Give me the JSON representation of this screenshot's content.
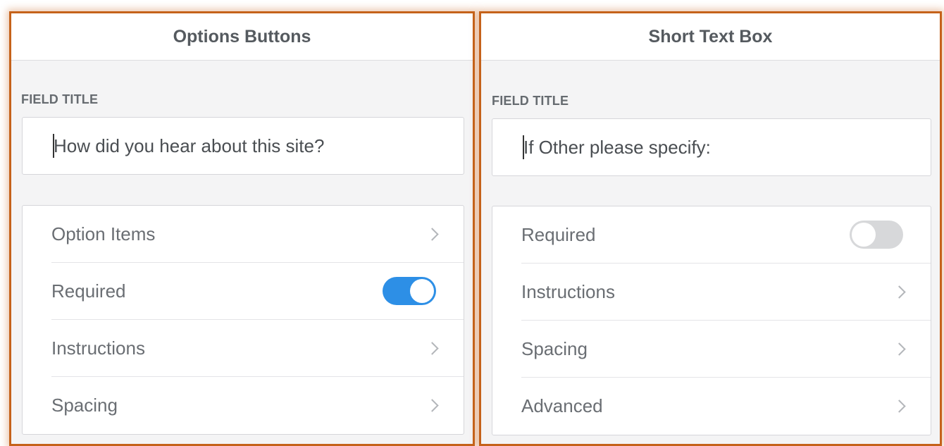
{
  "left_panel": {
    "header": "Options Buttons",
    "field_title_label": "FIELD TITLE",
    "field_title_value": "How did you hear about this site?",
    "rows": [
      {
        "label": "Option Items",
        "control": "chevron"
      },
      {
        "label": "Required",
        "control": "toggle",
        "toggle_state": "on"
      },
      {
        "label": "Instructions",
        "control": "chevron"
      },
      {
        "label": "Spacing",
        "control": "chevron"
      }
    ]
  },
  "right_panel": {
    "header": "Short Text Box",
    "field_title_label": "FIELD TITLE",
    "field_title_value": "If Other please specify:",
    "rows": [
      {
        "label": "Required",
        "control": "toggle",
        "toggle_state": "off"
      },
      {
        "label": "Instructions",
        "control": "chevron"
      },
      {
        "label": "Spacing",
        "control": "chevron"
      },
      {
        "label": "Advanced",
        "control": "chevron"
      }
    ]
  },
  "colors": {
    "highlight_border": "#c5621a",
    "toggle_on": "#2d8fe6",
    "toggle_off": "#d7d8da"
  }
}
